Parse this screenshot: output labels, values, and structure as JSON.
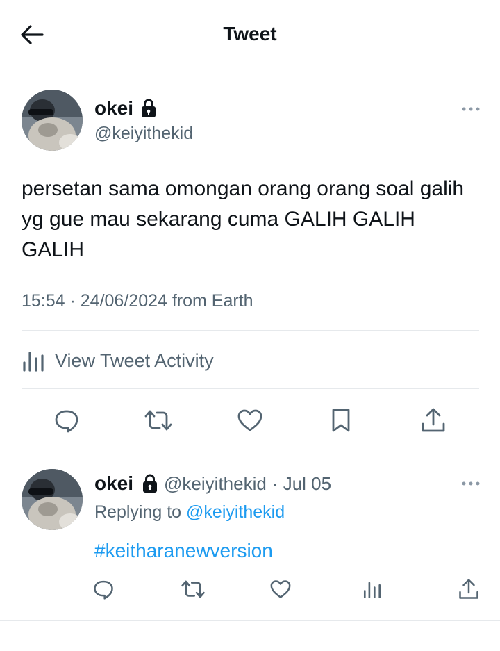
{
  "header": {
    "title": "Tweet"
  },
  "tweet": {
    "author_name": "okei",
    "author_handle": "@keiyithekid",
    "text": "persetan sama omongan orang orang soal galih yg gue mau sekarang cuma GALIH GALIH GALIH",
    "timestamp": "15:54 · 24/06/2024 from Earth",
    "activity_label": "View Tweet Activity",
    "actions": [
      "reply-icon",
      "retweet-icon",
      "like-icon",
      "bookmark-icon",
      "share-icon"
    ]
  },
  "reply": {
    "author_name": "okei",
    "author_handle": "@keiyithekid",
    "date": "· Jul 05",
    "replying_prefix": "Replying to",
    "replying_to": "@keiyithekid",
    "text": "#keitharanewversion",
    "actions": [
      "reply-icon",
      "retweet-icon",
      "like-icon",
      "analytics-icon",
      "share-icon"
    ]
  },
  "colors": {
    "text": "#0f1419",
    "muted": "#536471",
    "link": "#1d9bf0",
    "divider": "#e6e9ec"
  }
}
